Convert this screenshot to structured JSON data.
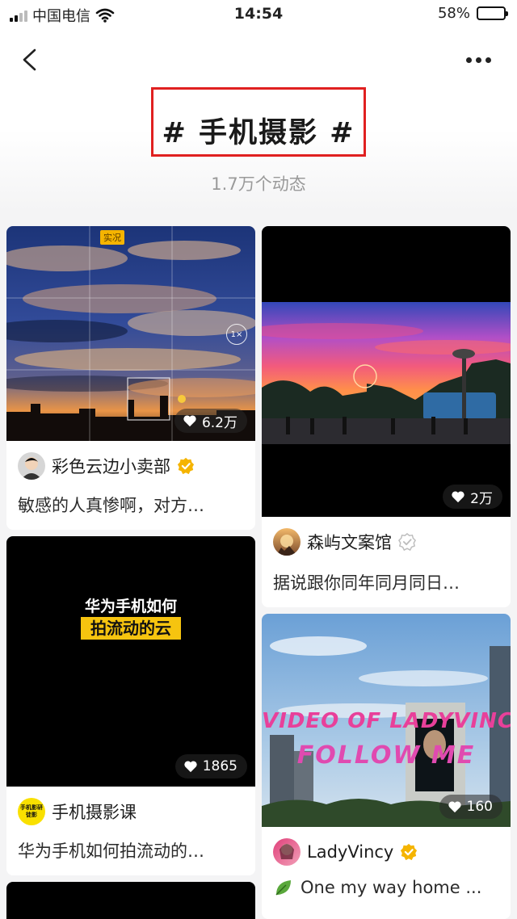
{
  "status_bar": {
    "carrier": "中国电信",
    "time": "14:54",
    "battery": "58%",
    "battery_level": 0.58
  },
  "header": {
    "title": "# 手机摄影 #",
    "subtitle": "1.7万个动态"
  },
  "feed": {
    "cards": [
      {
        "media_label": "实况",
        "zoom": "1×",
        "likes": "6.2万",
        "author": "彩色云边小卖部",
        "verified": true,
        "text": "敏感的人真惨啊，对方…"
      },
      {
        "likes": "2万",
        "author": "森屿文案馆",
        "verified": true,
        "text": "据说跟你同年同月同日…"
      },
      {
        "caption_line1": "华为手机如何",
        "caption_line2": "拍流动的云",
        "likes": "1865",
        "avatar_text": "手机影研\n徒影",
        "author": "手机摄影课",
        "verified": false,
        "text": "华为手机如何拍流动的…"
      },
      {
        "overlay_line1": "VIDEO OF LADYVINCY",
        "overlay_line2": "FOLLOW ME",
        "likes": "160",
        "author": "LadyVincy",
        "verified": true,
        "text": "One my way home ..."
      }
    ]
  },
  "colors": {
    "highlight_border": "#e02020",
    "verified_gold": "#f5b400",
    "caption_yellow": "#f6c40f"
  }
}
